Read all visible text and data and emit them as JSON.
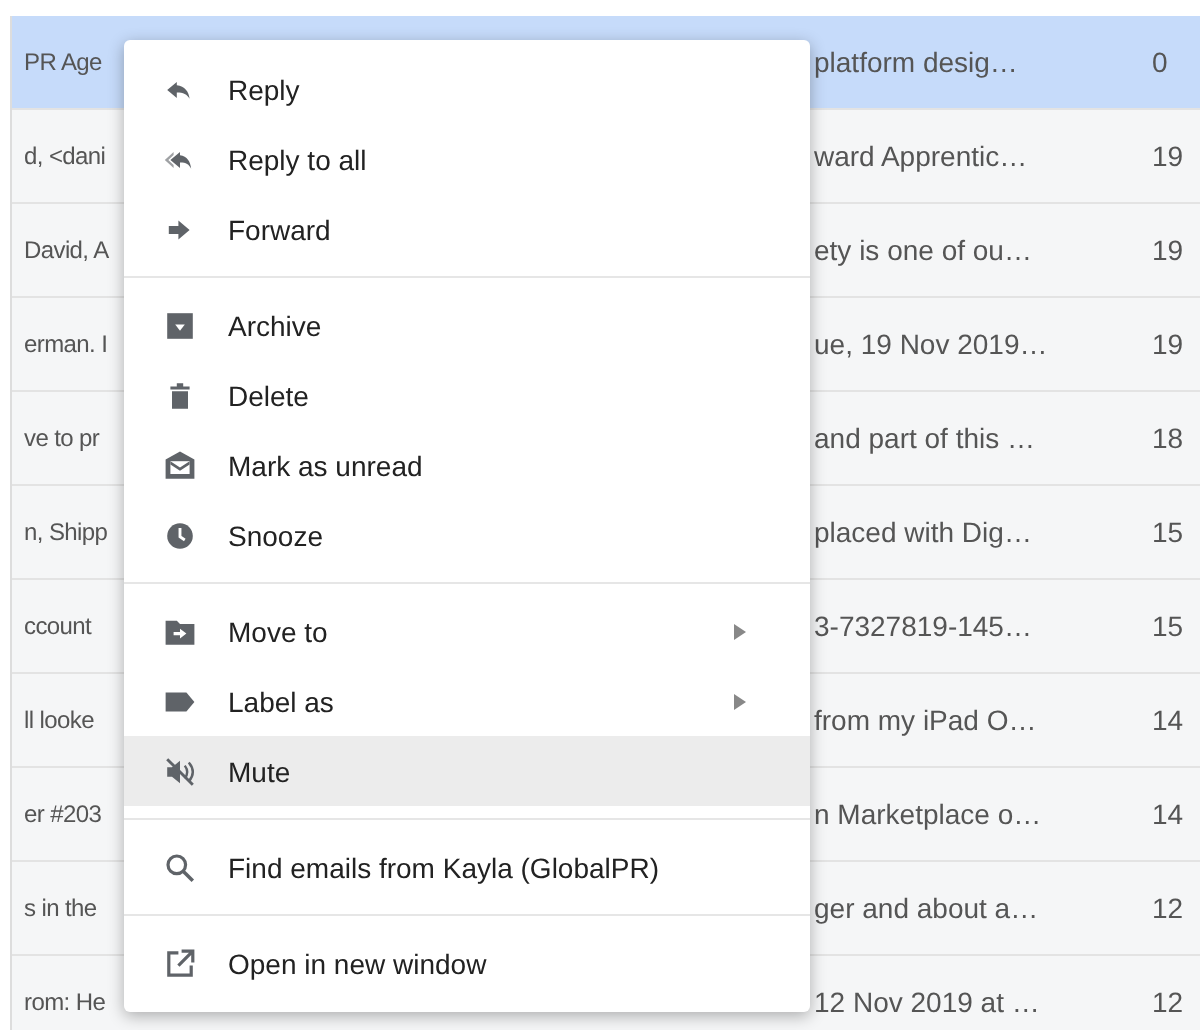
{
  "emails": [
    {
      "column_1": "PR Age",
      "column_2": "platform desig…",
      "column_3": "0",
      "selected": true
    },
    {
      "column_1": "d, <dani",
      "column_2": "ward Apprentic…",
      "column_3": "19",
      "selected": false
    },
    {
      "column_1": "David, A",
      "column_2": "ety is one of ou…",
      "column_3": "19",
      "selected": false
    },
    {
      "column_1": "erman. I",
      "column_2": "ue, 19 Nov 2019…",
      "column_3": "19",
      "selected": false
    },
    {
      "column_1": "ve to pr",
      "column_2": "and part of this …",
      "column_3": "18",
      "selected": false
    },
    {
      "column_1": "n, Shipp",
      "column_2": "placed with Dig…",
      "column_3": "15",
      "selected": false
    },
    {
      "column_1": "ccount",
      "column_2": "3-7327819-145…",
      "column_3": "15",
      "selected": false
    },
    {
      "column_1": "ll looke",
      "column_2": "from my iPad O…",
      "column_3": "14",
      "selected": false
    },
    {
      "column_1": "er #203",
      "column_2": "n Marketplace o…",
      "column_3": "14",
      "selected": false
    },
    {
      "column_1": "s in the",
      "column_2": "ger and about a…",
      "column_3": "12",
      "selected": false
    },
    {
      "column_1": "rom: He",
      "column_2": "12 Nov 2019 at …",
      "column_3": "12",
      "selected": false
    }
  ],
  "context_menu": {
    "sections": [
      {
        "items": [
          {
            "label": "Reply",
            "kind": "reply",
            "submenu": false,
            "highlighted": false
          },
          {
            "label": "Reply to all",
            "kind": "reply_all",
            "submenu": false,
            "highlighted": false
          },
          {
            "label": "Forward",
            "kind": "forward",
            "submenu": false,
            "highlighted": false
          }
        ]
      },
      {
        "items": [
          {
            "label": "Archive",
            "kind": "archive",
            "submenu": false,
            "highlighted": false
          },
          {
            "label": "Delete",
            "kind": "delete",
            "submenu": false,
            "highlighted": false
          },
          {
            "label": "Mark as unread",
            "kind": "unread",
            "submenu": false,
            "highlighted": false
          },
          {
            "label": "Snooze",
            "kind": "snooze",
            "submenu": false,
            "highlighted": false
          }
        ]
      },
      {
        "items": [
          {
            "label": "Move to",
            "kind": "move",
            "submenu": true,
            "highlighted": false
          },
          {
            "label": "Label as",
            "kind": "label",
            "submenu": true,
            "highlighted": false
          },
          {
            "label": "Mute",
            "kind": "mute",
            "submenu": false,
            "highlighted": true
          }
        ]
      },
      {
        "items": [
          {
            "label": "Find emails from Kayla (GlobalPR)",
            "kind": "search",
            "submenu": false,
            "highlighted": false
          }
        ]
      },
      {
        "items": [
          {
            "label": "Open in new window",
            "kind": "open_window",
            "submenu": false,
            "highlighted": false
          }
        ]
      }
    ]
  }
}
